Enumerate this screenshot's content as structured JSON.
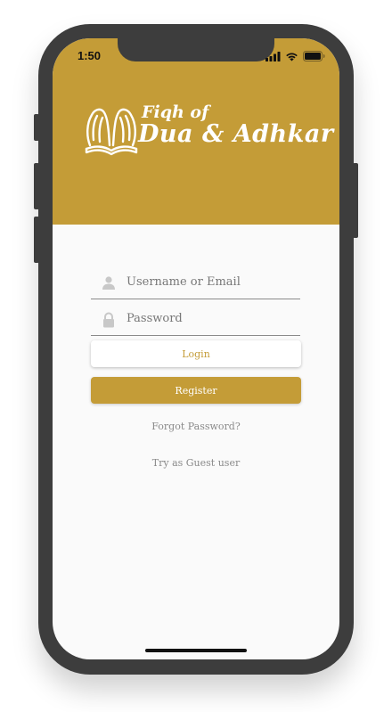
{
  "status_bar": {
    "time": "1:50",
    "icons": [
      "signal-icon",
      "wifi-icon",
      "battery-icon"
    ]
  },
  "header": {
    "background_color": "#c49c37",
    "logo": {
      "line1": "Fiqh of",
      "line2": "Dua & Adhkar",
      "icon": "praying-hands-icon"
    }
  },
  "form": {
    "username": {
      "placeholder": "Username or Email",
      "value": "",
      "icon": "user-icon"
    },
    "password": {
      "placeholder": "Password",
      "value": "",
      "icon": "lock-icon"
    },
    "login_label": "Login",
    "register_label": "Register",
    "forgot_password_label": "Forgot Password?",
    "guest_label": "Try as Guest user"
  },
  "colors": {
    "accent": "#c49c37",
    "background": "#fafafa",
    "device_frame": "#3d3d3d"
  }
}
